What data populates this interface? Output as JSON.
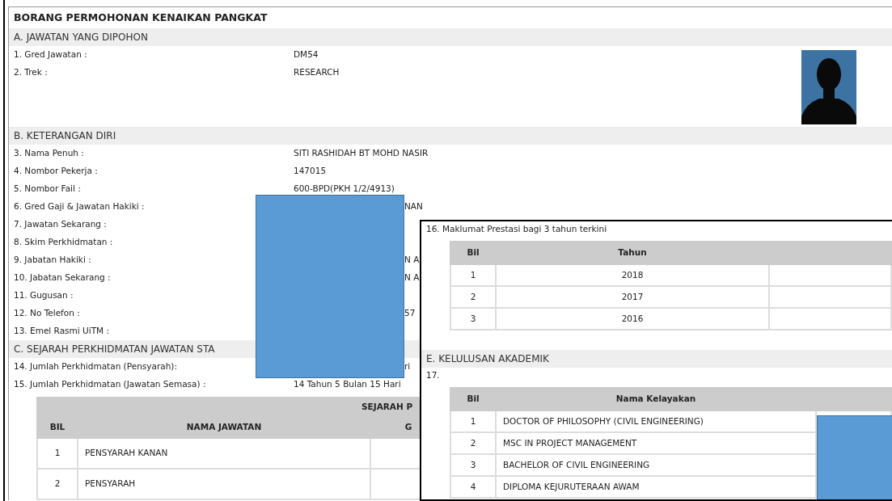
{
  "title": "BORANG PERMOHONAN KENAIKAN PANGKAT",
  "section_a": {
    "heading": "A. JAWATAN YANG DIPOHON",
    "fields": [
      {
        "label": "1. Gred Jawatan :",
        "value": "DM54"
      },
      {
        "label": "2. Trek :",
        "value": "RESEARCH"
      }
    ]
  },
  "section_b": {
    "heading": "B. KETERANGAN DIRI",
    "fields": [
      {
        "label": "3. Nama Penuh :",
        "value": "SITI RASHIDAH BT MOHD NASIR"
      },
      {
        "label": "4. Nombor Pekerja :",
        "value": "147015"
      },
      {
        "label": "5. Nombor Fail :",
        "value": "600-BPD(PKH 1/2/4913)"
      },
      {
        "label": "6. Gred Gaji & Jawatan Hakiki :",
        "value_fragment": "NAN"
      },
      {
        "label": "7. Jawatan Sekarang :"
      },
      {
        "label": "8. Skim Perkhidmatan :"
      },
      {
        "label": "9. Jabatan Hakiki :",
        "value_fragment": "N A"
      },
      {
        "label": "10. Jabatan Sekarang :",
        "value_fragment": "N A"
      },
      {
        "label": "11. Gugusan :"
      },
      {
        "label": "12. No Telefon :",
        "value_fragment": "57"
      },
      {
        "label": "13. Emel Rasmi UiTM :"
      }
    ]
  },
  "section_c": {
    "heading": "C. SEJARAH PERKHIDMATAN JAWATAN STA",
    "fields": [
      {
        "label": "14. Jumlah Perkhidmatan (Pensyarah):",
        "value_fragment": "ri"
      },
      {
        "label": "15. Jumlah Perkhidmatan (Jawatan Semasa) :",
        "value": "14 Tahun 5 Bulan 15 Hari"
      }
    ],
    "table": {
      "caption": "SEJARAH P",
      "columns": [
        "BIL",
        "NAMA JAWATAN",
        "G"
      ],
      "rows": [
        [
          "1",
          "PENSYARAH KANAN"
        ],
        [
          "2",
          "PENSYARAH"
        ]
      ]
    }
  },
  "overlay": {
    "performance": {
      "label": "16. Maklumat Prestasi bagi 3 tahun terkini",
      "columns": [
        "Bil",
        "Tahun"
      ],
      "rows": [
        [
          "1",
          "2018"
        ],
        [
          "2",
          "2017"
        ],
        [
          "3",
          "2016"
        ]
      ]
    },
    "education": {
      "heading": "E. KELULUSAN AKADEMIK",
      "label": "17.",
      "columns": [
        "Bil",
        "Nama Kelayakan"
      ],
      "rows": [
        [
          "1",
          "DOCTOR OF PHILOSOPHY (CIVIL ENGINEERING)"
        ],
        [
          "2",
          "MSC IN PROJECT MANAGEMENT"
        ],
        [
          "3",
          "BACHELOR OF CIVIL ENGINEERING"
        ],
        [
          "4",
          "DIPLOMA KEJURUTERAAN AWAM"
        ]
      ]
    }
  }
}
